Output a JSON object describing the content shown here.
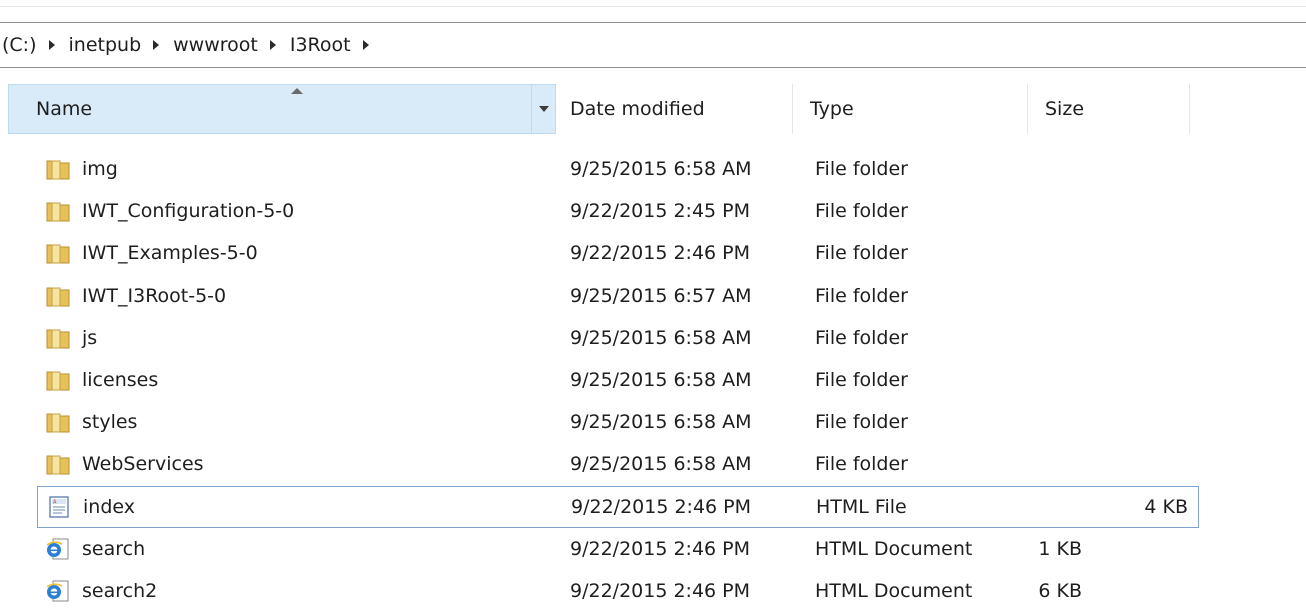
{
  "breadcrumb": {
    "items": [
      "(C:)",
      "inetpub",
      "wwwroot",
      "I3Root"
    ]
  },
  "columns": {
    "name": "Name",
    "date_modified": "Date modified",
    "type": "Type",
    "size": "Size"
  },
  "files": [
    {
      "name": "img",
      "date": "9/25/2015 6:58 AM",
      "type": "File folder",
      "size": "",
      "icon": "folder-icon"
    },
    {
      "name": "IWT_Configuration-5-0",
      "date": "9/22/2015 2:45 PM",
      "type": "File folder",
      "size": "",
      "icon": "folder-icon"
    },
    {
      "name": "IWT_Examples-5-0",
      "date": "9/22/2015 2:46 PM",
      "type": "File folder",
      "size": "",
      "icon": "folder-icon"
    },
    {
      "name": "IWT_I3Root-5-0",
      "date": "9/25/2015 6:57 AM",
      "type": "File folder",
      "size": "",
      "icon": "folder-icon"
    },
    {
      "name": "js",
      "date": "9/25/2015 6:58 AM",
      "type": "File folder",
      "size": "",
      "icon": "folder-icon"
    },
    {
      "name": "licenses",
      "date": "9/25/2015 6:58 AM",
      "type": "File folder",
      "size": "",
      "icon": "folder-icon"
    },
    {
      "name": "styles",
      "date": "9/25/2015 6:58 AM",
      "type": "File folder",
      "size": "",
      "icon": "folder-icon"
    },
    {
      "name": "WebServices",
      "date": "9/25/2015 6:58 AM",
      "type": "File folder",
      "size": "",
      "icon": "folder-icon"
    },
    {
      "name": "index",
      "date": "9/22/2015 2:46 PM",
      "type": "HTML File",
      "size": "4 KB",
      "icon": "html-file-icon"
    },
    {
      "name": "search",
      "date": "9/22/2015 2:46 PM",
      "type": "HTML Document",
      "size": "1 KB",
      "icon": "ie-document-icon"
    },
    {
      "name": "search2",
      "date": "9/22/2015 2:46 PM",
      "type": "HTML Document",
      "size": "6 KB",
      "icon": "ie-document-icon"
    }
  ],
  "colors": {
    "header_selected_bg": "#d9ebf9",
    "row_selected_border": "#7da2ce",
    "folder": "#e8c15b"
  }
}
